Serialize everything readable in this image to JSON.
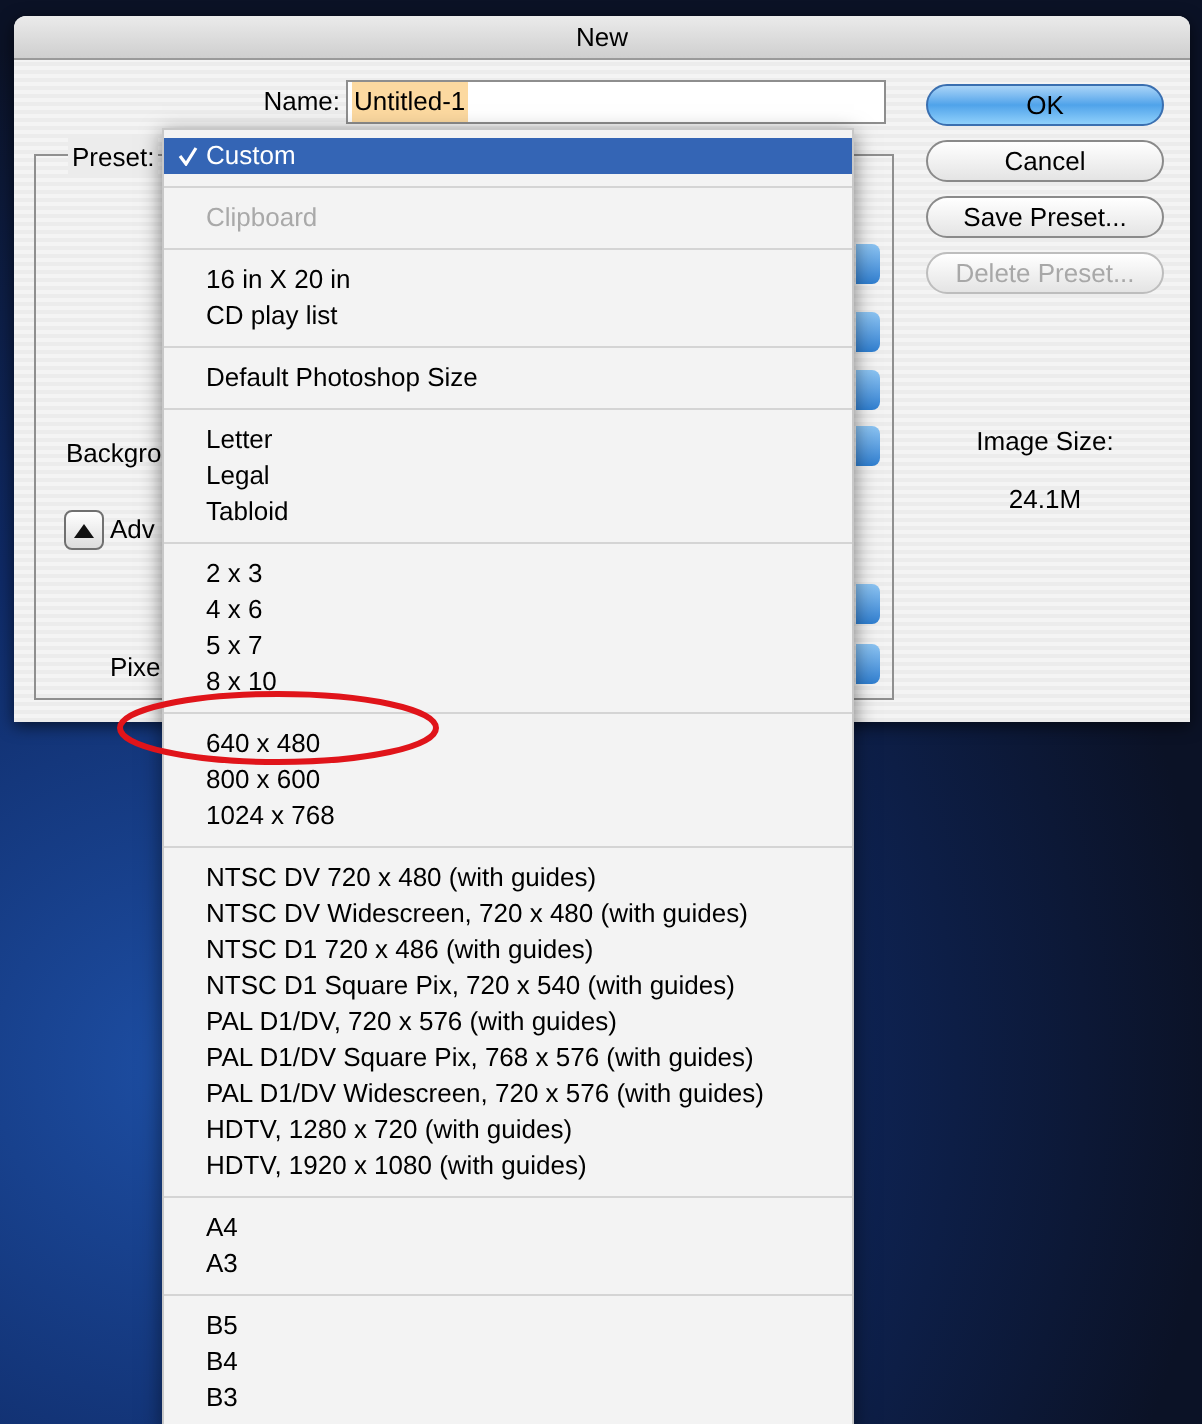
{
  "window": {
    "title": "New"
  },
  "name_field": {
    "label": "Name:",
    "value": "Untitled-1"
  },
  "preset_label": "Preset:",
  "background_label": "Backgro",
  "advanced": {
    "label": "Adv",
    "expanded": true
  },
  "pixel_label": "Pixe",
  "image_size": {
    "label": "Image Size:",
    "value": "24.1M"
  },
  "buttons": [
    {
      "label": "OK",
      "default": true,
      "disabled": false
    },
    {
      "label": "Cancel",
      "default": false,
      "disabled": false
    },
    {
      "label": "Save Preset...",
      "default": false,
      "disabled": false
    },
    {
      "label": "Delete Preset...",
      "default": false,
      "disabled": true
    }
  ],
  "preset_menu": {
    "groups": [
      [
        {
          "label": "Custom",
          "selected": true,
          "disabled": false
        }
      ],
      [
        {
          "label": "Clipboard",
          "selected": false,
          "disabled": true
        }
      ],
      [
        {
          "label": "16 in X 20 in",
          "selected": false,
          "disabled": false
        },
        {
          "label": "CD play list",
          "selected": false,
          "disabled": false
        }
      ],
      [
        {
          "label": "Default Photoshop Size",
          "selected": false,
          "disabled": false
        }
      ],
      [
        {
          "label": "Letter",
          "selected": false,
          "disabled": false
        },
        {
          "label": "Legal",
          "selected": false,
          "disabled": false
        },
        {
          "label": "Tabloid",
          "selected": false,
          "disabled": false
        }
      ],
      [
        {
          "label": "2 x 3",
          "selected": false,
          "disabled": false
        },
        {
          "label": "4 x 6",
          "selected": false,
          "disabled": false
        },
        {
          "label": "5 x 7",
          "selected": false,
          "disabled": false
        },
        {
          "label": "8 x 10",
          "selected": false,
          "disabled": false
        }
      ],
      [
        {
          "label": "640 x 480",
          "selected": false,
          "disabled": false
        },
        {
          "label": "800 x 600",
          "selected": false,
          "disabled": false
        },
        {
          "label": "1024 x 768",
          "selected": false,
          "disabled": false
        }
      ],
      [
        {
          "label": "NTSC DV 720 x 480 (with guides)",
          "selected": false,
          "disabled": false
        },
        {
          "label": "NTSC DV Widescreen, 720 x 480 (with guides)",
          "selected": false,
          "disabled": false
        },
        {
          "label": "NTSC D1 720 x 486 (with guides)",
          "selected": false,
          "disabled": false
        },
        {
          "label": "NTSC D1 Square Pix, 720 x 540 (with guides)",
          "selected": false,
          "disabled": false
        },
        {
          "label": "PAL D1/DV, 720 x 576 (with guides)",
          "selected": false,
          "disabled": false
        },
        {
          "label": "PAL D1/DV Square Pix, 768 x 576 (with guides)",
          "selected": false,
          "disabled": false
        },
        {
          "label": "PAL D1/DV Widescreen, 720 x 576 (with guides)",
          "selected": false,
          "disabled": false
        },
        {
          "label": "HDTV, 1280 x 720 (with guides)",
          "selected": false,
          "disabled": false
        },
        {
          "label": "HDTV, 1920 x 1080 (with guides)",
          "selected": false,
          "disabled": false
        }
      ],
      [
        {
          "label": "A4",
          "selected": false,
          "disabled": false
        },
        {
          "label": "A3",
          "selected": false,
          "disabled": false
        }
      ],
      [
        {
          "label": "B5",
          "selected": false,
          "disabled": false
        },
        {
          "label": "B4",
          "selected": false,
          "disabled": false
        },
        {
          "label": "B3",
          "selected": false,
          "disabled": false
        }
      ]
    ]
  }
}
